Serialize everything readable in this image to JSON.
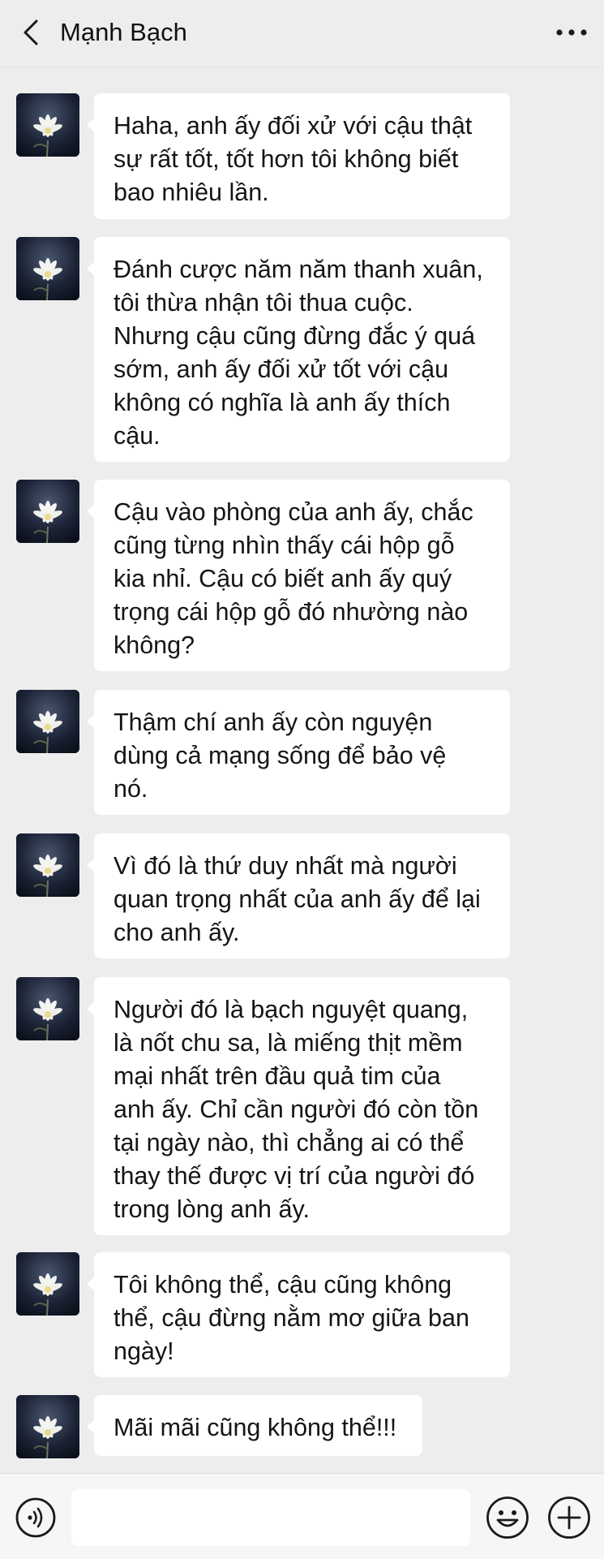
{
  "header": {
    "contact_name": "Mạnh Bạch"
  },
  "icons": {
    "back": "chevron-left-icon",
    "more": "more-dots-icon",
    "avatar": "white-lotus-flower",
    "voice": "voice-icon",
    "emoji": "emoji-icon",
    "plus": "plus-icon"
  },
  "colors": {
    "background": "#ededed",
    "bubble": "#ffffff",
    "text": "#151515"
  },
  "messages": [
    {
      "text": "Haha, anh ấy đối xử với cậu thật\nsự rất tốt, tốt hơn tôi không biết\nbao nhiêu lần."
    },
    {
      "text": "Đánh cược năm năm thanh xuân,\ntôi thừa nhận tôi thua cuộc.\nNhưng cậu cũng đừng đắc ý quá\nsớm, anh ấy đối xử tốt với cậu\nkhông có nghĩa là anh ấy thích\ncậu."
    },
    {
      "text": "Cậu vào phòng của anh ấy, chắc\ncũng từng nhìn thấy cái hộp gỗ\nkia nhỉ. Cậu có biết anh ấy quý\ntrọng cái hộp gỗ đó nhường nào\nkhông?"
    },
    {
      "text": "Thậm chí anh ấy còn nguyện\ndùng cả mạng sống để bảo vệ\nnó."
    },
    {
      "text": "Vì đó là thứ duy nhất mà người\nquan trọng nhất của anh ấy để lại\ncho anh ấy."
    },
    {
      "text": "Người đó là bạch nguyệt quang,\nlà nốt chu sa, là miếng thịt mềm\nmại nhất trên đầu quả tim của\nanh ấy. Chỉ cần người đó còn tồn\ntại ngày nào, thì chẳng ai có thể\nthay thế được vị trí của người đó\ntrong lòng anh ấy."
    },
    {
      "text": "Tôi không thể, cậu cũng không\nthể, cậu đừng nằm mơ giữa ban\nngày!"
    },
    {
      "text": "Mãi mãi cũng không thể!!!"
    }
  ],
  "input": {
    "value": "",
    "placeholder": ""
  }
}
